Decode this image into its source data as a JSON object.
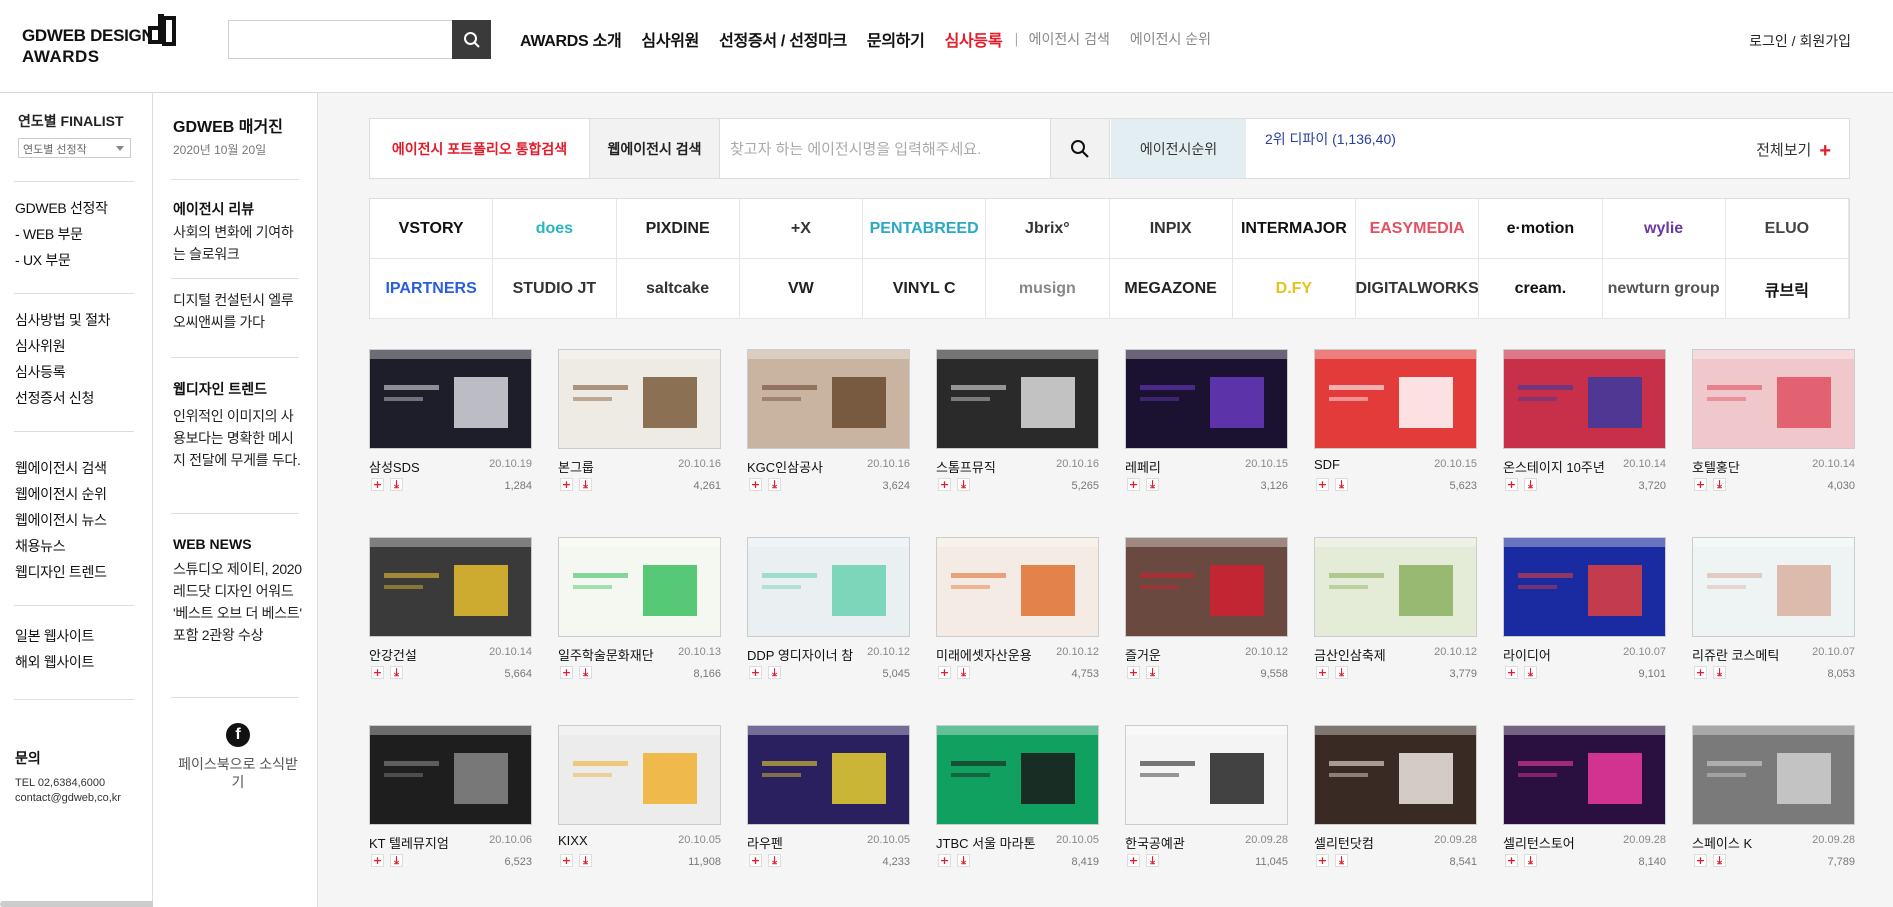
{
  "header": {
    "logo_line1": "GDWEB DESIGN",
    "logo_line2": "AWARDS",
    "search_placeholder": "",
    "nav": [
      "AWARDS 소개",
      "심사위원",
      "선정증서 / 선정마크",
      "문의하기"
    ],
    "nav_red": "심사등록",
    "nav_sep": "|",
    "nav_sub": [
      "에이전시 검색",
      "에이전시 순위"
    ],
    "member": "로그인 / 회원가입"
  },
  "lnb": {
    "finalist_title": "연도별 FINALIST",
    "finalist_select": "연도별 선정작",
    "group1": [
      "GDWEB 선정작",
      "- WEB 부문",
      "- UX 부문"
    ],
    "group2": [
      "심사방법 및 절차",
      "심사위원",
      "심사등록",
      "선정증서 신청"
    ],
    "group3": [
      "웹에이전시 검색",
      "웹에이전시 순위",
      "웹에이전시 뉴스",
      "채용뉴스",
      "웹디자인 트렌드"
    ],
    "group4": [
      "일본 웹사이트",
      "해외 웹사이트"
    ],
    "contact_title": "문의",
    "contact_tel": "TEL 02,6384,6000",
    "contact_mail": "contact@gdweb,co,kr"
  },
  "magazine": {
    "title": "GDWEB 매거진",
    "date": "2020년 10월 20일",
    "blocks": [
      {
        "h": "에이전시 리뷰",
        "p": "사회의 변화에 기여하는 슬로워크"
      },
      {
        "h": "",
        "p": "디지털 컨설턴시 엘루오씨앤씨를 가다"
      },
      {
        "h": "웹디자인 트렌드",
        "p": "인위적인 이미지의 사용보다는 명확한 메시지 전달에 무게를 두다."
      },
      {
        "h": "WEB NEWS",
        "p": "스튜디오 제이티, 2020 레드닷 디자인 어워드 '베스트 오브 더 베스트' 포함 2관왕 수상"
      }
    ],
    "facebook": "페이스북으로 소식받기"
  },
  "searchbar": {
    "tab1": "에이전시 포트폴리오 통합검색",
    "tab2": "웹에이전시 검색",
    "placeholder": "찾고자 하는 에이전시명을 입력해주세요.",
    "rank_label": "에이전시순위",
    "rank_value": "2위  디파이 (1,136,40)",
    "view_all": "전체보기"
  },
  "agency_logos": [
    {
      "text": "VSTORY",
      "color": "#111111"
    },
    {
      "text": "does",
      "color": "#2bb5c2"
    },
    {
      "text": "PIXDINE",
      "color": "#222222"
    },
    {
      "text": "+X",
      "color": "#333333"
    },
    {
      "text": "PENTABREED",
      "color": "#2aa8c4"
    },
    {
      "text": "Jbrix°",
      "color": "#333333"
    },
    {
      "text": "INPIX",
      "color": "#333333"
    },
    {
      "text": "INTERMAJOR",
      "color": "#111111"
    },
    {
      "text": "EASYMEDIA",
      "color": "#e45060"
    },
    {
      "text": "e·motion",
      "color": "#111111"
    },
    {
      "text": "wylie",
      "color": "#6b3aa0"
    },
    {
      "text": "ELUO",
      "color": "#444444"
    },
    {
      "text": "IPARTNERS",
      "color": "#2a5de0"
    },
    {
      "text": "STUDIO JT",
      "color": "#333333"
    },
    {
      "text": "saltcake",
      "color": "#333333"
    },
    {
      "text": "VW",
      "color": "#222222"
    },
    {
      "text": "VINYL C",
      "color": "#222222"
    },
    {
      "text": "musign",
      "color": "#888888"
    },
    {
      "text": "MEGAZONE",
      "color": "#222222"
    },
    {
      "text": "D.FY",
      "color": "#e8c21a"
    },
    {
      "text": "DIGITALWORKS",
      "color": "#333333"
    },
    {
      "text": "cream.",
      "color": "#111111"
    },
    {
      "text": "newturn group",
      "color": "#555555"
    },
    {
      "text": "큐브릭",
      "color": "#111111"
    }
  ],
  "portfolio": [
    {
      "name": "삼성SDS",
      "date": "20.10.19",
      "views": "1,284",
      "bg": "#1e1e2a",
      "accent": "#d8d8e0"
    },
    {
      "name": "본그룹",
      "date": "20.10.16",
      "views": "4,261",
      "bg": "#eeeae4",
      "accent": "#7a5a3a"
    },
    {
      "name": "KGC인삼공사",
      "date": "20.10.16",
      "views": "3,624",
      "bg": "#c8b4a0",
      "accent": "#6a4a30"
    },
    {
      "name": "스톰프뮤직",
      "date": "20.10.16",
      "views": "5,265",
      "bg": "#2a2a2a",
      "accent": "#dddddd"
    },
    {
      "name": "레페리",
      "date": "20.10.15",
      "views": "3,126",
      "bg": "#1a1230",
      "accent": "#6a3ac0"
    },
    {
      "name": "SDF",
      "date": "20.10.15",
      "views": "5,623",
      "bg": "#e33a3a",
      "accent": "#ffffff"
    },
    {
      "name": "온스테이지 10주년",
      "date": "20.10.14",
      "views": "3,720",
      "bg": "#c8304a",
      "accent": "#3a3aa0"
    },
    {
      "name": "호텔홍단",
      "date": "20.10.14",
      "views": "4,030",
      "bg": "#f0c8cc",
      "accent": "#e05060"
    },
    {
      "name": "안강건설",
      "date": "20.10.14",
      "views": "5,664",
      "bg": "#3a3a3a",
      "accent": "#e8c030"
    },
    {
      "name": "일주학술문화재단",
      "date": "20.10.13",
      "views": "8,166",
      "bg": "#f4f8f0",
      "accent": "#3ac060"
    },
    {
      "name": "DDP 영디자이너 참",
      "date": "20.10.12",
      "views": "5,045",
      "bg": "#eaeff2",
      "accent": "#6ad0b0"
    },
    {
      "name": "미래에셋자산운용",
      "date": "20.10.12",
      "views": "4,753",
      "bg": "#f4ece4",
      "accent": "#e07030"
    },
    {
      "name": "즐거운",
      "date": "20.10.12",
      "views": "9,558",
      "bg": "#6a4a40",
      "accent": "#d02030"
    },
    {
      "name": "금산인삼축제",
      "date": "20.10.12",
      "views": "3,779",
      "bg": "#e4ecd8",
      "accent": "#8ab060"
    },
    {
      "name": "라이디어",
      "date": "20.10.07",
      "views": "9,101",
      "bg": "#1a2aa0",
      "accent": "#e04040"
    },
    {
      "name": "리쥬란 코스메틱",
      "date": "20.10.07",
      "views": "8,053",
      "bg": "#eef4f4",
      "accent": "#d8b0a0"
    },
    {
      "name": "KT 텔레뮤지엄",
      "date": "20.10.06",
      "views": "6,523",
      "bg": "#1e1e1e",
      "accent": "#888888"
    },
    {
      "name": "KIXX",
      "date": "20.10.05",
      "views": "11,908",
      "bg": "#ececec",
      "accent": "#f0b030"
    },
    {
      "name": "라우펜",
      "date": "20.10.05",
      "views": "4,233",
      "bg": "#2a2060",
      "accent": "#e8d030"
    },
    {
      "name": "JTBC 서울 마라톤",
      "date": "20.10.05",
      "views": "8,419",
      "bg": "#10a060",
      "accent": "#1a1a1a"
    },
    {
      "name": "한국공예관",
      "date": "20.09.28",
      "views": "11,045",
      "bg": "#f4f4f4",
      "accent": "#222222"
    },
    {
      "name": "셀리턴닷컴",
      "date": "20.09.28",
      "views": "8,541",
      "bg": "#3a2a24",
      "accent": "#f0e8e0"
    },
    {
      "name": "셀리턴스토어",
      "date": "20.09.28",
      "views": "8,140",
      "bg": "#2a1040",
      "accent": "#f03aa0"
    },
    {
      "name": "스페이스 K",
      "date": "20.09.28",
      "views": "7,789",
      "bg": "#7a7a7a",
      "accent": "#d0d0d0"
    }
  ]
}
